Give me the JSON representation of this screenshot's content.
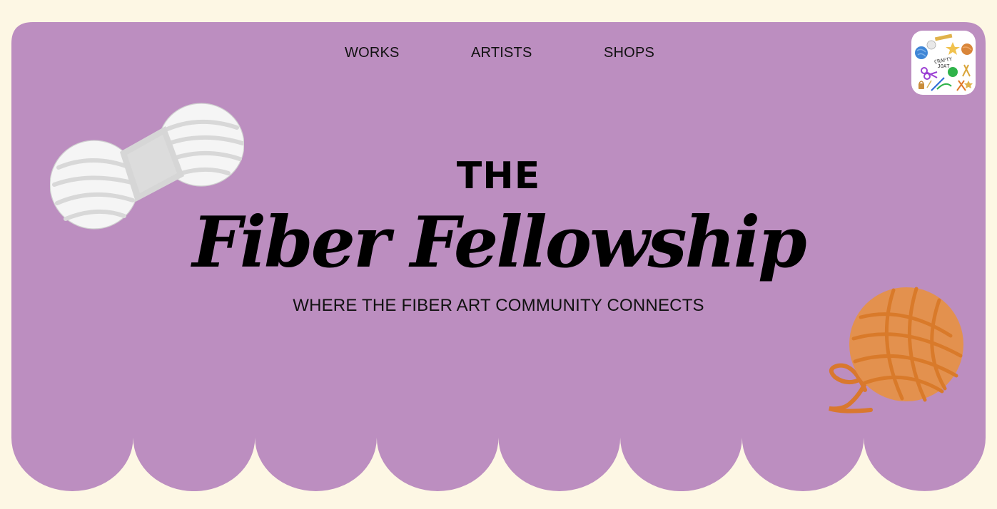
{
  "nav": {
    "items": [
      {
        "label": "WORKS"
      },
      {
        "label": "ARTISTS"
      },
      {
        "label": "SHOPS"
      }
    ]
  },
  "logo": {
    "text": "CRAFTY JOAT",
    "icon": "crafty-joat-logo"
  },
  "hero": {
    "title_prefix": "THE",
    "title": "Fiber Fellowship",
    "tagline": "WHERE THE FIBER ART COMMUNITY CONNECTS"
  },
  "colors": {
    "page_background": "#fdf7e4",
    "hero_background": "#bc8ec0",
    "text": "#000000",
    "yarn_white": "#f4f4f4",
    "yarn_orange": "#e08a48"
  },
  "decorations": [
    {
      "icon": "white-yarn-skein-icon"
    },
    {
      "icon": "orange-yarn-ball-icon"
    }
  ]
}
